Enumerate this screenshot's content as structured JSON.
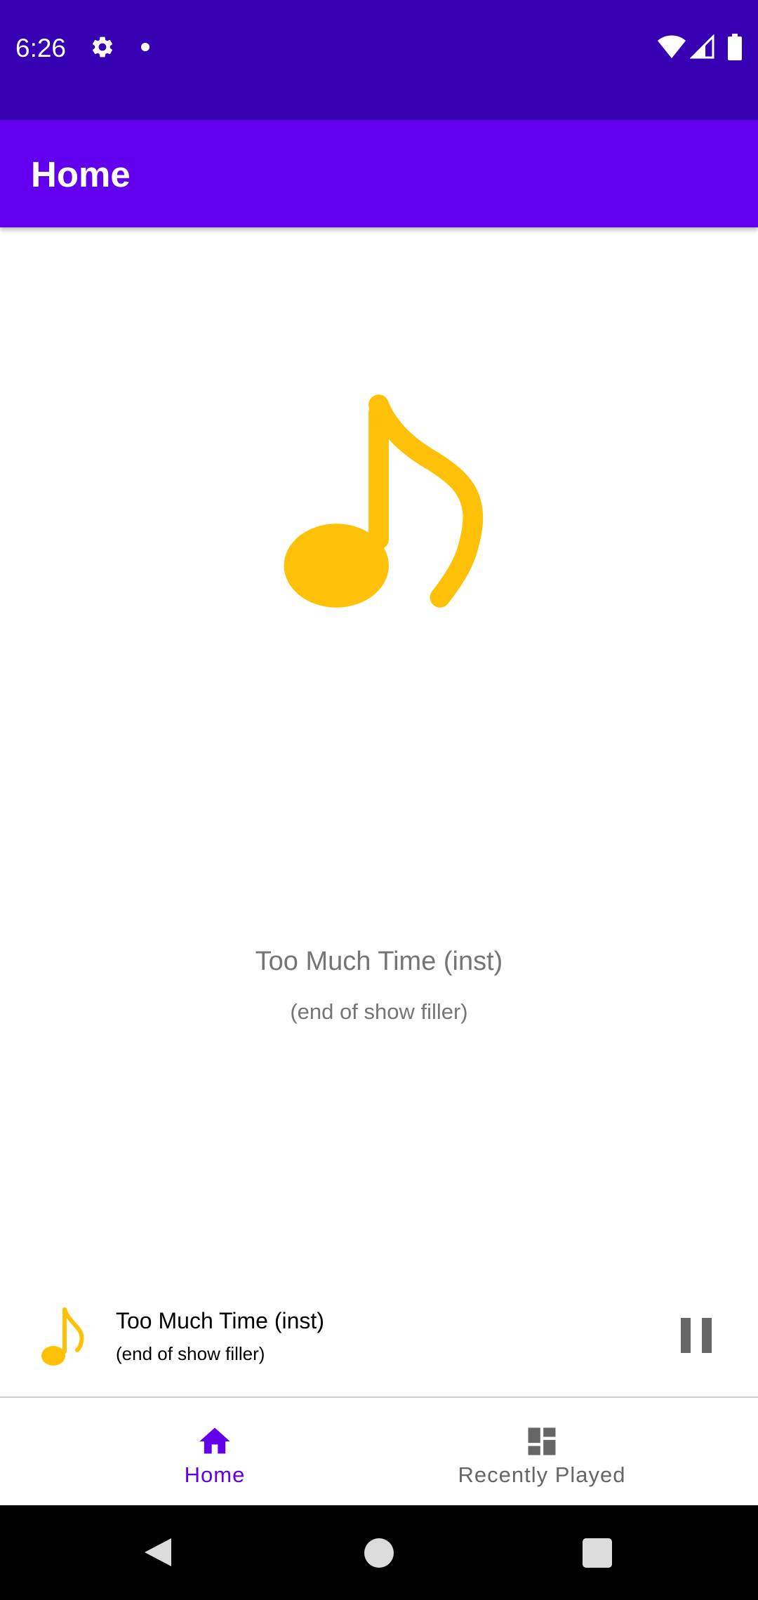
{
  "status_bar": {
    "time": "6:26",
    "icons": [
      "gear-icon",
      "notification-dot-icon",
      "wifi-icon",
      "signal-icon",
      "battery-icon"
    ],
    "background": "#3700b3"
  },
  "app_bar": {
    "title": "Home",
    "background": "#6200ee"
  },
  "now_playing": {
    "icon": "music-note-icon",
    "icon_color": "#ffc107",
    "title": "Too Much Time (inst)",
    "subtitle": "(end of show filler)"
  },
  "mini_player": {
    "icon": "music-note-icon",
    "title": "Too Much Time (inst)",
    "subtitle": "(end of show filler)",
    "action_icon": "pause-icon"
  },
  "bottom_nav": {
    "items": [
      {
        "label": "Home",
        "icon": "home-icon",
        "selected": true
      },
      {
        "label": "Recently Played",
        "icon": "dashboard-icon",
        "selected": false
      }
    ],
    "accent": "#6200ee"
  },
  "system_nav": {
    "buttons": [
      "back-icon",
      "home-circle-icon",
      "recents-square-icon"
    ]
  }
}
